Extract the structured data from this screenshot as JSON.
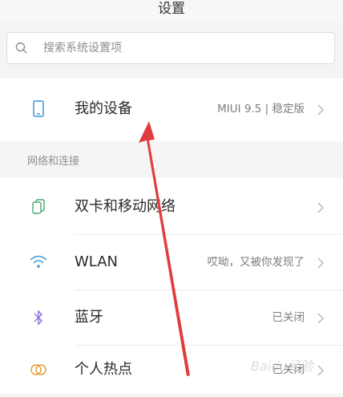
{
  "header": {
    "title": "设置"
  },
  "search": {
    "placeholder": "搜索系统设置项",
    "icon": "search-icon"
  },
  "device": {
    "label": "我的设备",
    "value": "MIUI 9.5 | 稳定版",
    "icon": "phone-icon"
  },
  "section": {
    "title": "网络和连接"
  },
  "items": [
    {
      "label": "双卡和移动网络",
      "value": "",
      "icon": "dual-sim-icon"
    },
    {
      "label": "WLAN",
      "value": "哎呦，又被你发现了",
      "icon": "wifi-icon"
    },
    {
      "label": "蓝牙",
      "value": "已关闭",
      "icon": "bluetooth-icon"
    },
    {
      "label": "个人热点",
      "value": "已关闭",
      "icon": "hotspot-icon"
    }
  ],
  "colors": {
    "arrow": "#e23b3b",
    "icon_blue": "#3b97d6",
    "icon_green": "#4aa76a",
    "icon_purple": "#8c6fd8",
    "icon_orange": "#e59a2b"
  },
  "watermark": {
    "text": "Baidu经验"
  }
}
